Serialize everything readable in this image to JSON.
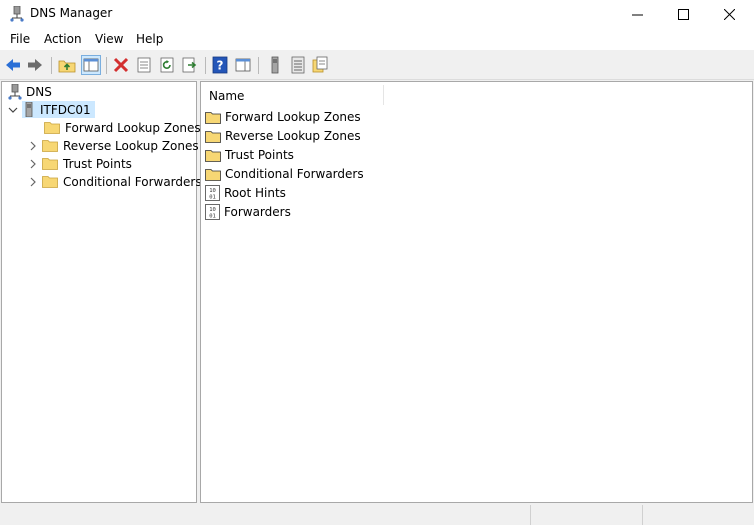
{
  "window": {
    "title": "DNS Manager",
    "minimize": "—",
    "maximize": "☐",
    "close": "✕"
  },
  "menu": [
    "File",
    "Action",
    "View",
    "Help"
  ],
  "tree": {
    "root": "DNS",
    "server": "ITFDC01",
    "children": [
      "Forward Lookup Zones",
      "Reverse Lookup Zones",
      "Trust Points",
      "Conditional Forwarders"
    ]
  },
  "details": {
    "column_name": "Name",
    "items": [
      {
        "label": "Forward Lookup Zones",
        "icon": "folder-icon"
      },
      {
        "label": "Reverse Lookup Zones",
        "icon": "folder-icon"
      },
      {
        "label": "Trust Points",
        "icon": "folder-icon"
      },
      {
        "label": "Conditional Forwarders",
        "icon": "folder-icon"
      },
      {
        "label": "Root Hints",
        "icon": "binary-file-icon"
      },
      {
        "label": "Forwarders",
        "icon": "binary-file-icon"
      }
    ]
  },
  "colors": {
    "selection": "#cce8ff",
    "folder": "#f7d774",
    "accent_blue": "#2a6fd6",
    "delete_red": "#d32f2f"
  }
}
